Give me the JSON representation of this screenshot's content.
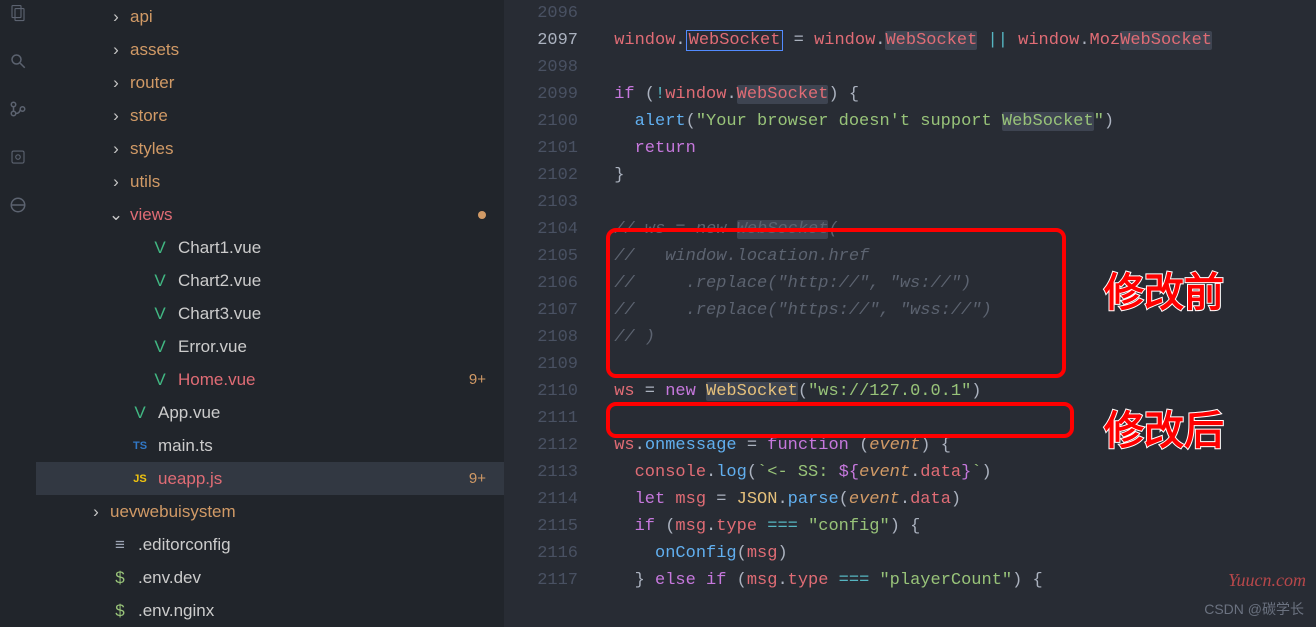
{
  "activity": [
    "files-icon",
    "search-icon",
    "scm-icon",
    "debug-icon",
    "ext-icon"
  ],
  "tree": [
    {
      "indent": 72,
      "chev": ">",
      "icon": "",
      "name": "api",
      "cls": "folder-name"
    },
    {
      "indent": 72,
      "chev": ">",
      "icon": "",
      "name": "assets",
      "cls": "folder-name"
    },
    {
      "indent": 72,
      "chev": ">",
      "icon": "",
      "name": "router",
      "cls": "folder-name"
    },
    {
      "indent": 72,
      "chev": ">",
      "icon": "",
      "name": "store",
      "cls": "folder-name"
    },
    {
      "indent": 72,
      "chev": ">",
      "icon": "",
      "name": "styles",
      "cls": "folder-name"
    },
    {
      "indent": 72,
      "chev": ">",
      "icon": "",
      "name": "utils",
      "cls": "folder-name"
    },
    {
      "indent": 72,
      "chev": "v",
      "icon": "",
      "name": "views",
      "cls": "folder-open",
      "dot": true
    },
    {
      "indent": 92,
      "chev": "",
      "icon": "V",
      "iconCls": "vue-icon",
      "name": "Chart1.vue",
      "cls": "file-name"
    },
    {
      "indent": 92,
      "chev": "",
      "icon": "V",
      "iconCls": "vue-icon",
      "name": "Chart2.vue",
      "cls": "file-name"
    },
    {
      "indent": 92,
      "chev": "",
      "icon": "V",
      "iconCls": "vue-icon",
      "name": "Chart3.vue",
      "cls": "file-name"
    },
    {
      "indent": 92,
      "chev": "",
      "icon": "V",
      "iconCls": "vue-icon",
      "name": "Error.vue",
      "cls": "file-name"
    },
    {
      "indent": 92,
      "chev": "",
      "icon": "V",
      "iconCls": "vue-icon",
      "name": "Home.vue",
      "cls": "file-highlight",
      "badge": "9+"
    },
    {
      "indent": 72,
      "chev": "",
      "icon": "V",
      "iconCls": "vue-icon",
      "name": "App.vue",
      "cls": "file-name"
    },
    {
      "indent": 72,
      "chev": "",
      "icon": "TS",
      "iconCls": "ts-icon",
      "name": "main.ts",
      "cls": "file-name"
    },
    {
      "indent": 72,
      "chev": "",
      "icon": "JS",
      "iconCls": "js-icon",
      "name": "ueapp.js",
      "cls": "file-highlight",
      "badge": "9+",
      "selected": true
    },
    {
      "indent": 52,
      "chev": ">",
      "icon": "",
      "name": "uevwebuisystem",
      "cls": "folder-name"
    },
    {
      "indent": 52,
      "chev": "",
      "icon": "≡",
      "iconCls": "gear-icon",
      "name": ".editorconfig",
      "cls": "file-name"
    },
    {
      "indent": 52,
      "chev": "",
      "icon": "$",
      "iconCls": "dollar-icon",
      "name": ".env.dev",
      "cls": "file-name"
    },
    {
      "indent": 52,
      "chev": "",
      "icon": "$",
      "iconCls": "dollar-icon",
      "name": ".env.nginx",
      "cls": "file-name"
    }
  ],
  "code": {
    "lines": [
      2096,
      2097,
      2098,
      2099,
      2100,
      2101,
      2102,
      2103,
      2104,
      2105,
      2106,
      2107,
      2108,
      2109,
      2110,
      2111,
      2112,
      2113,
      2114,
      2115,
      2116,
      2117
    ],
    "activeLine": 2097,
    "l2097": {
      "a": "window",
      "b": "WebSocket",
      "c": " = ",
      "d": "window",
      "e": "WebSocket",
      "f": " || ",
      "g": "window",
      "h": "MozWebSocket"
    },
    "l2099": {
      "a": "if",
      "b": " (",
      "c": "!",
      "d": "window",
      "e": ".",
      "f": "WebSocket",
      "g": ") {"
    },
    "l2100": {
      "a": "alert",
      "b": "(",
      "c": "\"Your browser doesn't support ",
      "d": "WebSocket",
      "e": "\"",
      "f": ")"
    },
    "l2101": {
      "a": "return"
    },
    "l2102": {
      "a": "}"
    },
    "l2104": {
      "a": "// ws = new ",
      "b": "WebSocket",
      "c": "("
    },
    "l2105": {
      "a": "//   window.location.href"
    },
    "l2106": {
      "a": "//     .replace(\"http://\", \"ws://\")"
    },
    "l2107": {
      "a": "//     .replace(\"https://\", \"wss://\")"
    },
    "l2108": {
      "a": "// )"
    },
    "l2110": {
      "a": "ws",
      "b": " = ",
      "c": "new",
      "d": " ",
      "e": "WebSocket",
      "f": "(",
      "g": "\"ws://127.0.0.1\"",
      "h": ")"
    },
    "l2112": {
      "a": "ws",
      "b": ".",
      "c": "onmessage",
      "d": " = ",
      "e": "function",
      "f": " (",
      "g": "event",
      "h": ") {"
    },
    "l2113": {
      "a": "console",
      "b": ".",
      "c": "log",
      "d": "(",
      "e": "`<- SS: ",
      "f": "${",
      "g": "event",
      "h": ".",
      "i": "data",
      "j": "}",
      "k": "`",
      "l": ")"
    },
    "l2114": {
      "a": "let",
      "b": " ",
      "c": "msg",
      "d": " = ",
      "e": "JSON",
      "f": ".",
      "g": "parse",
      "h": "(",
      "i": "event",
      "j": ".",
      "k": "data",
      "l": ")"
    },
    "l2115": {
      "a": "if",
      "b": " (",
      "c": "msg",
      "d": ".",
      "e": "type",
      "f": " === ",
      "g": "\"config\"",
      "h": ") {"
    },
    "l2116": {
      "a": "onConfig",
      "b": "(",
      "c": "msg",
      "d": ")"
    },
    "l2117": {
      "a": "} ",
      "b": "else if",
      "c": " (",
      "d": "msg",
      "e": ".",
      "f": "type",
      "g": " === ",
      "h": "\"playerCount\"",
      "i": ") {"
    }
  },
  "annot": {
    "before": "修改前",
    "after": "修改后"
  },
  "watermark": "Yuucn.com",
  "attribution": "CSDN @碳学长"
}
